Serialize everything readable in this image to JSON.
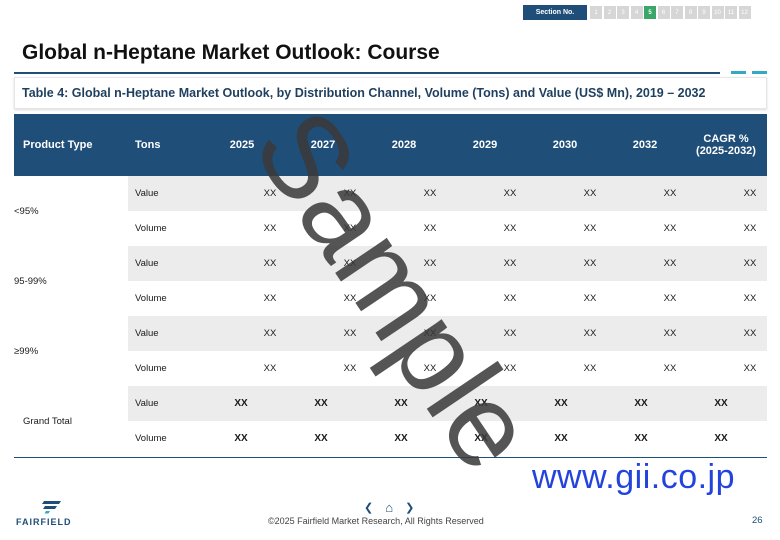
{
  "section_nav": {
    "label": "Section No.",
    "items": [
      "1",
      "2",
      "3",
      "4",
      "5",
      "6",
      "7",
      "8",
      "9",
      "10",
      "11",
      "12"
    ],
    "active": "5"
  },
  "page_title": "Global n-Heptane Market Outlook: Course",
  "table_caption": "Table 4: Global n-Heptane Market Outlook, by Distribution Channel, Volume (Tons) and Value (US$ Mn), 2019 – 2032",
  "table": {
    "headers": {
      "product_type": "Product Type",
      "tons": "Tons",
      "years": [
        "2025",
        "2027",
        "2028",
        "2029",
        "2030",
        "2032"
      ],
      "cagr": "CAGR % (2025-2032)"
    },
    "groups": [
      {
        "name": "<95%",
        "rows": [
          {
            "label": "Value",
            "cells": [
              "XX",
              "XX",
              "XX",
              "XX",
              "XX",
              "XX",
              "XX"
            ]
          },
          {
            "label": "Volume",
            "cells": [
              "XX",
              "XX",
              "XX",
              "XX",
              "XX",
              "XX",
              "XX"
            ]
          }
        ]
      },
      {
        "name": "95-99%",
        "rows": [
          {
            "label": "Value",
            "cells": [
              "XX",
              "XX",
              "XX",
              "XX",
              "XX",
              "XX",
              "XX"
            ]
          },
          {
            "label": "Volume",
            "cells": [
              "XX",
              "XX",
              "XX",
              "XX",
              "XX",
              "XX",
              "XX"
            ]
          }
        ]
      },
      {
        "name": "≥99%",
        "rows": [
          {
            "label": "Value",
            "cells": [
              "XX",
              "XX",
              "XX",
              "XX",
              "XX",
              "XX",
              "XX"
            ]
          },
          {
            "label": "Volume",
            "cells": [
              "XX",
              "XX",
              "XX",
              "XX",
              "XX",
              "XX",
              "XX"
            ]
          }
        ]
      },
      {
        "name": "Grand Total",
        "rows": [
          {
            "label": "Value",
            "cells": [
              "XX",
              "XX",
              "XX",
              "XX",
              "XX",
              "XX",
              "XX"
            ]
          },
          {
            "label": "Volume",
            "cells": [
              "XX",
              "XX",
              "XX",
              "XX",
              "XX",
              "XX",
              "XX"
            ]
          }
        ]
      }
    ]
  },
  "watermark": "Sample",
  "site": "www.gii.co.jp",
  "footer": {
    "logo_text": "FAIRFIELD",
    "copyright": "©2025 Fairfield Market Research, All Rights Reserved",
    "page_number": "26",
    "prev_symbol": "❮",
    "home_symbol": "⌂",
    "next_symbol": "❯"
  },
  "colors": {
    "primary": "#1f4e79",
    "accent": "#35a9c1",
    "active_section": "#3aa66a",
    "site_link": "#2244dd"
  }
}
